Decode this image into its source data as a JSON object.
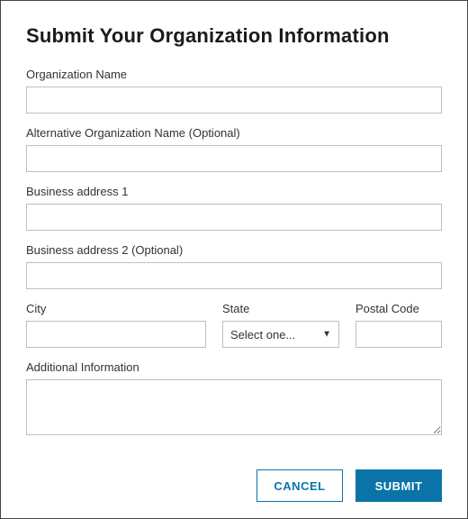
{
  "title": "Submit Your Organization Information",
  "fields": {
    "org_name": {
      "label": "Organization Name",
      "value": ""
    },
    "alt_org_name": {
      "label": "Alternative Organization Name  (Optional)",
      "value": ""
    },
    "addr1": {
      "label": "Business address 1",
      "value": ""
    },
    "addr2": {
      "label": "Business address 2  (Optional)",
      "value": ""
    },
    "city": {
      "label": "City",
      "value": ""
    },
    "state": {
      "label": "State",
      "selected": "Select one..."
    },
    "postal": {
      "label": "Postal Code",
      "value": ""
    },
    "additional": {
      "label": "Additional Information",
      "value": ""
    }
  },
  "buttons": {
    "cancel": "CANCEL",
    "submit": "SUBMIT"
  }
}
